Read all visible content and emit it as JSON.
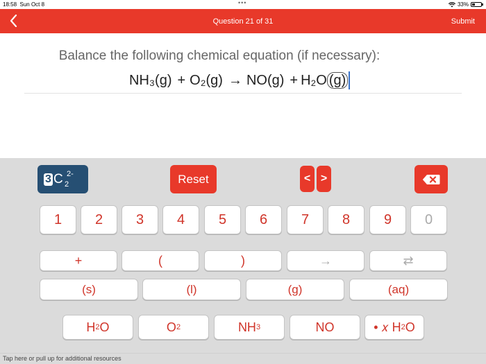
{
  "status_bar": {
    "time": "18:58",
    "date": "Sun Oct 8",
    "battery": "33%",
    "battery_level": 0.33
  },
  "header": {
    "title": "Question 21 of 31",
    "submit_label": "Submit",
    "back_icon": "chevron-left-icon"
  },
  "question": {
    "prompt": "Balance the following chemical equation (if necessary):",
    "terms": [
      {
        "formula": "NH₃",
        "state": "(g)"
      },
      {
        "formula": "O₂",
        "state": "(g)"
      },
      {
        "formula": "NO",
        "state": "(g)"
      },
      {
        "formula": "H₂O",
        "state": "(g)"
      }
    ],
    "plus": "+",
    "arrow": "→"
  },
  "keyboard": {
    "mode_button": {
      "digit": "3",
      "letter": "C",
      "charge": "2-",
      "subscript": "2"
    },
    "reset_label": "Reset",
    "left_arrow": "<",
    "right_arrow": ">",
    "backspace_icon": "backspace-icon",
    "numbers": [
      "1",
      "2",
      "3",
      "4",
      "5",
      "6",
      "7",
      "8",
      "9",
      "0"
    ],
    "symbols": [
      "+",
      "(",
      ")",
      "→",
      "⇄"
    ],
    "states": [
      "(s)",
      "(l)",
      "(g)",
      "(aq)"
    ],
    "molecules": [
      {
        "base": "H",
        "sub": "2",
        "tail": "O"
      },
      {
        "base": "O",
        "sub": "2",
        "tail": ""
      },
      {
        "base": "NH",
        "sub": "3",
        "tail": ""
      },
      {
        "base": "NO",
        "sub": "",
        "tail": ""
      },
      {
        "base": "• 𝑥 H",
        "sub": "2",
        "tail": "O"
      }
    ]
  },
  "footer": {
    "hint": "Tap here or pull up for additional resources"
  }
}
